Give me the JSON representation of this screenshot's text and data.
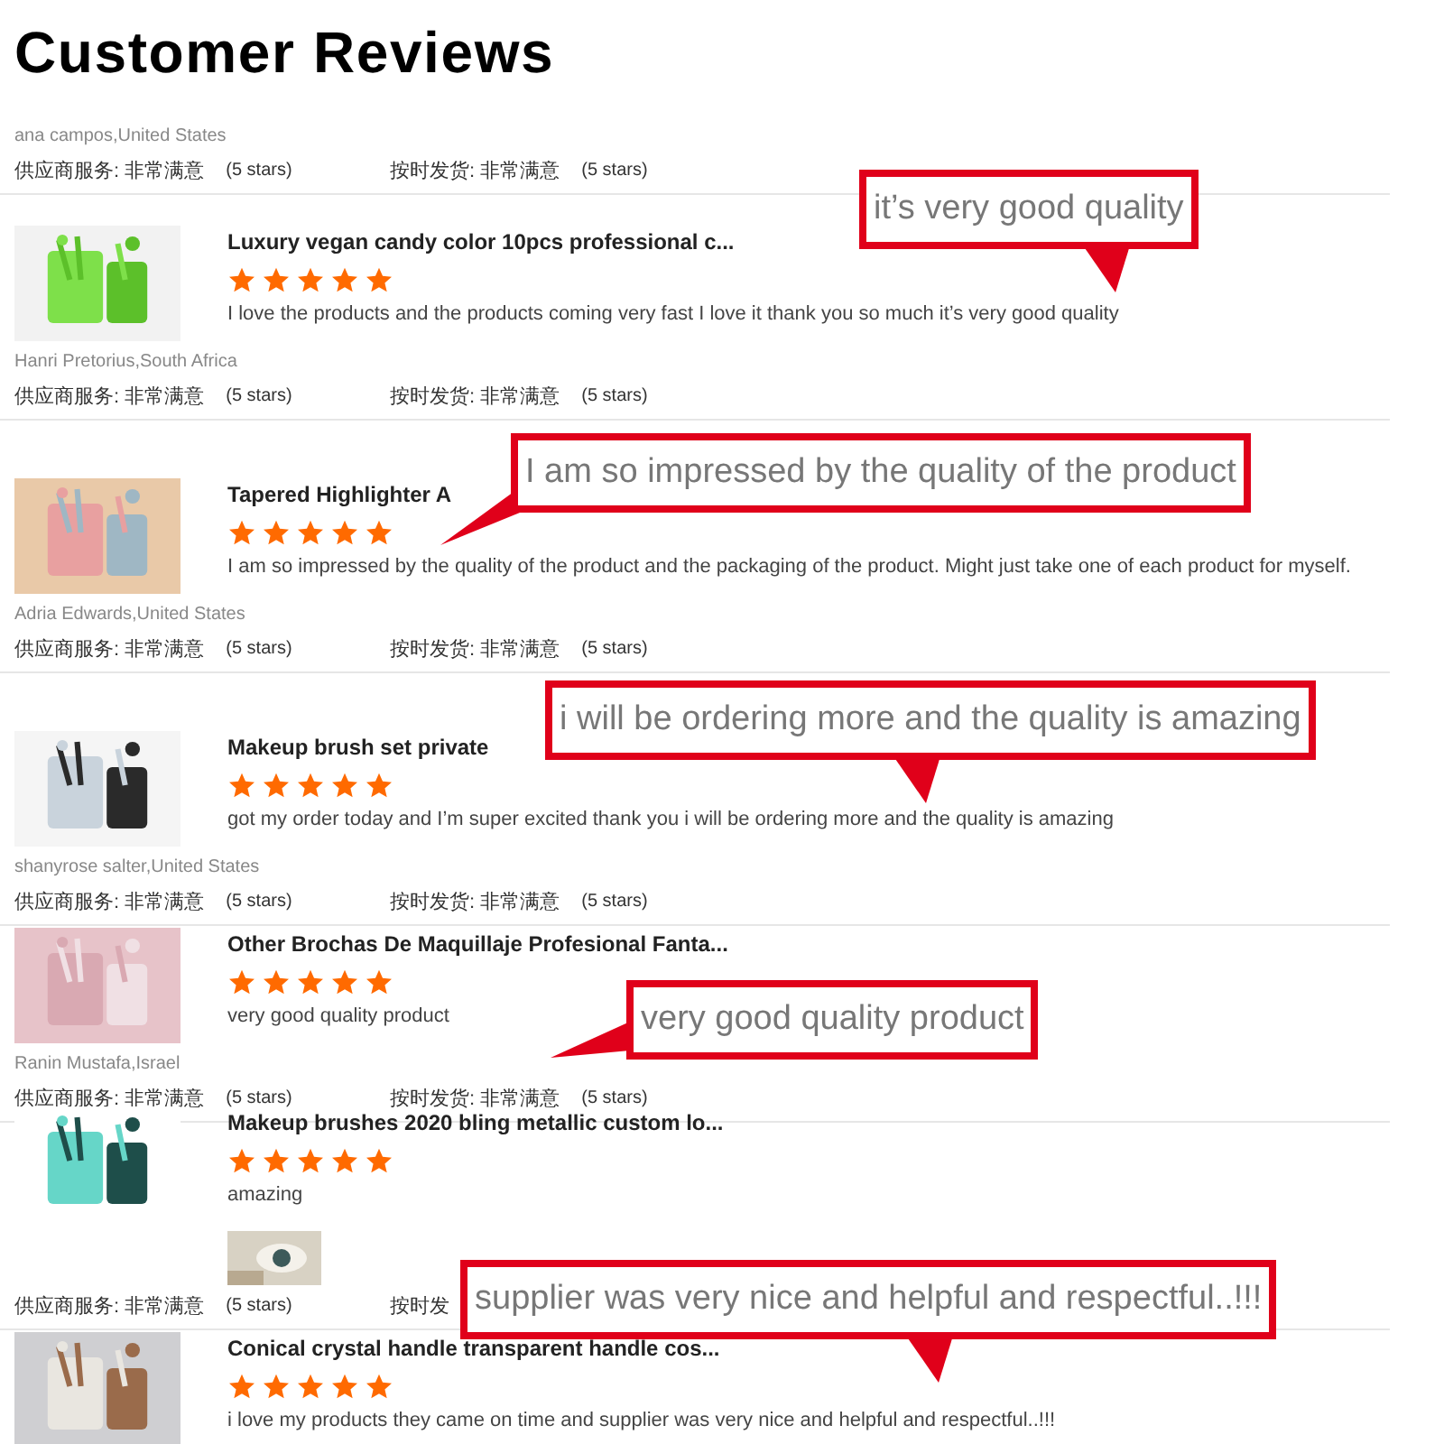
{
  "heading": "Customer Reviews",
  "reviews": [
    {
      "author": "ana campos,United States",
      "ratings": [
        {
          "label": "供应商服务: 非常满意",
          "value": "(5 stars)"
        },
        {
          "label": "按时发货: 非常满意",
          "value": "(5 stars)"
        }
      ]
    },
    {
      "title": "Luxury vegan candy color 10pcs professional c...",
      "stars": 5,
      "text": "I love the products and the products coming very fast I love it  thank you so much it’s very good quality",
      "author": "Hanri Pretorius,South Africa",
      "ratings": [
        {
          "label": "供应商服务: 非常满意",
          "value": "(5 stars)"
        },
        {
          "label": "按时发货: 非常满意",
          "value": "(5 stars)"
        }
      ]
    },
    {
      "title": "Tapered Highlighter A",
      "stars": 5,
      "text": "I am so impressed by the quality of the product and the packaging of the product. Might just take one of each product for myself.",
      "author": "Adria Edwards,United States",
      "ratings": [
        {
          "label": "供应商服务: 非常满意",
          "value": "(5 stars)"
        },
        {
          "label": "按时发货: 非常满意",
          "value": "(5 stars)"
        }
      ]
    },
    {
      "title": "Makeup brush set private",
      "stars": 5,
      "text": "got my order today and I’m super excited thank you i will be ordering more and the quality is amazing",
      "author": "shanyrose salter,United States",
      "ratings": [
        {
          "label": "供应商服务: 非常满意",
          "value": "(5 stars)"
        },
        {
          "label": "按时发货: 非常满意",
          "value": "(5 stars)"
        }
      ]
    },
    {
      "title": "Other Brochas De Maquillaje Profesional Fanta...",
      "stars": 5,
      "text": "very good quality product",
      "author": "Ranin Mustafa,Israel",
      "ratings": [
        {
          "label": "供应商服务: 非常满意",
          "value": "(5 stars)"
        },
        {
          "label": "按时发货: 非常满意",
          "value": "(5 stars)"
        }
      ]
    },
    {
      "title": "Makeup brushes 2020 bling metallic custom lo...",
      "stars": 5,
      "text": "amazing",
      "ratings": [
        {
          "label": "供应商服务: 非常满意",
          "value": "(5 stars)"
        },
        {
          "label": "按时发"
        }
      ]
    },
    {
      "title": "Conical crystal handle transparent handle cos...",
      "stars": 5,
      "text": "i love my products they came on time and supplier was very nice and helpful and respectful..!!!"
    }
  ],
  "callouts": [
    {
      "text": "it’s very good quality"
    },
    {
      "text": "I am so impressed by the quality of the product"
    },
    {
      "text": "i will be ordering more and the quality is amazing"
    },
    {
      "text": "very good quality product"
    },
    {
      "text": "supplier was very nice and helpful and respectful..!!!"
    }
  ]
}
